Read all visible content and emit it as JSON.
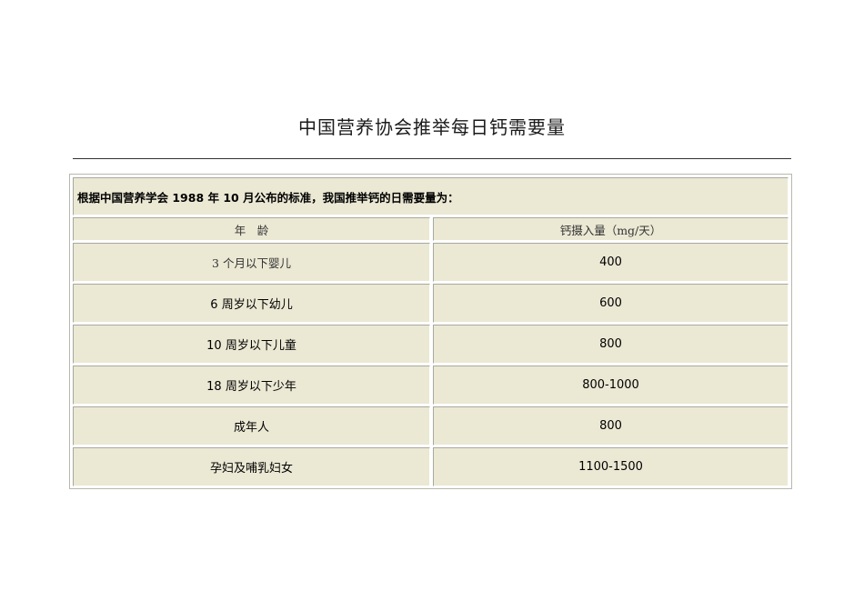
{
  "title": "中国营养协会推举每日钙需要量",
  "table": {
    "intro": "根据中国营养学会 1988 年 10 月公布的标准，我国推举钙的日需要量为：",
    "headers": [
      "年　龄",
      "钙摄入量（mg/天）"
    ],
    "rows": [
      [
        "3 个月以下婴儿",
        "400"
      ],
      [
        "6 周岁以下幼儿",
        "600"
      ],
      [
        "10 周岁以下儿童",
        "800"
      ],
      [
        "18 周岁以下少年",
        "800-1000"
      ],
      [
        "成年人",
        "800"
      ],
      [
        "孕妇及哺乳妇女",
        "1100-1500"
      ]
    ]
  }
}
